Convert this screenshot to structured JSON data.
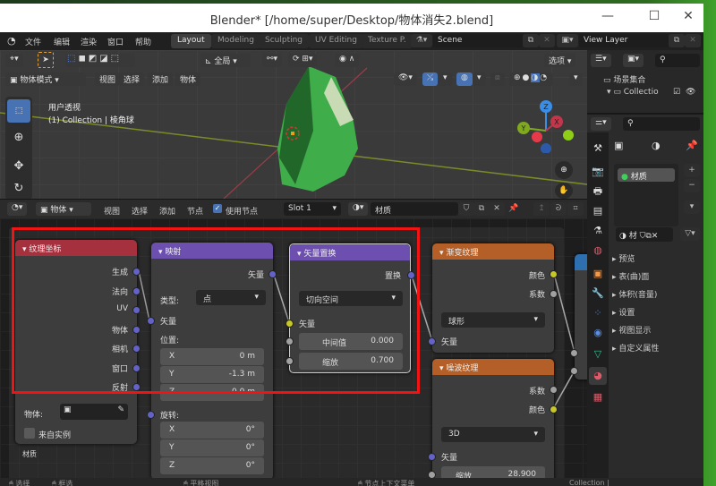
{
  "window": {
    "title": "Blender* [/home/super/Desktop/物体消失2.blend]",
    "minimize": "—",
    "maximize": "☐",
    "close": "✕"
  },
  "menubar": {
    "items": [
      "文件",
      "编辑",
      "渲染",
      "窗口",
      "帮助"
    ]
  },
  "workspaces": [
    {
      "label": "Layout",
      "active": true
    },
    {
      "label": "Modeling"
    },
    {
      "label": "Sculpting"
    },
    {
      "label": "UV Editing"
    },
    {
      "label": "Texture P."
    }
  ],
  "scene": {
    "name": "Scene",
    "view_layer": "View Layer"
  },
  "viewport": {
    "orientation": "全局",
    "options": "选项",
    "mode": "物体模式",
    "menus": [
      "视图",
      "选择",
      "添加",
      "物体"
    ],
    "overlay_title": "用户透视",
    "overlay_sub": "(1) Collection | 棱角球",
    "gizmo": {
      "x": "X",
      "y": "Y",
      "z": "Z"
    }
  },
  "node_editor": {
    "object_type": "物体",
    "menus": [
      "视图",
      "选择",
      "添加",
      "节点"
    ],
    "use_nodes_label": "使用节点",
    "use_nodes": true,
    "slot": "Slot 1",
    "material": "材质",
    "frame_label": "材质"
  },
  "nodes": {
    "texcoord": {
      "title": "纹理坐标",
      "outputs": [
        "生成",
        "法向",
        "UV",
        "物体",
        "相机",
        "窗口",
        "反射"
      ],
      "object_label": "物体:",
      "from_instancer": "来自实例"
    },
    "mapping": {
      "title": "映射",
      "output": "矢量",
      "type_label": "类型:",
      "type_value": "点",
      "vector_in": "矢量",
      "location_label": "位置:",
      "location": [
        {
          "axis": "X",
          "value": "0 m"
        },
        {
          "axis": "Y",
          "value": "-1.3 m"
        },
        {
          "axis": "Z",
          "value": "0.0 m"
        }
      ],
      "rotation_label": "旋转:",
      "rotation": [
        {
          "axis": "X",
          "value": "0°"
        },
        {
          "axis": "Y",
          "value": "0°"
        },
        {
          "axis": "Z",
          "value": "0°"
        }
      ]
    },
    "displacement": {
      "title": "矢量置换",
      "output": "置换",
      "space": "切向空间",
      "vector_in": "矢量",
      "midlevel_label": "中间值",
      "midlevel": "0.000",
      "scale_label": "缩放",
      "scale": "0.700"
    },
    "gradient": {
      "title": "渐变纹理",
      "outputs": [
        "颜色",
        "系数"
      ],
      "type": "球形",
      "vector_in": "矢量"
    },
    "noise": {
      "title": "噪波纹理",
      "outputs": [
        "系数",
        "颜色"
      ],
      "dims": "3D",
      "vector_in": "矢量",
      "scale_label": "缩放",
      "scale": "28.900"
    }
  },
  "outliner": {
    "root": "场景集合",
    "collection": "Collectio"
  },
  "properties": {
    "material_slot": "材质",
    "material_short": "材",
    "panels": [
      "预览",
      "表(曲)面",
      "体积(音量)",
      "设置",
      "视图显示",
      "自定义属性"
    ]
  },
  "statusbar": {
    "select": "选择",
    "box_select": "框选",
    "pan": "平移视图",
    "node_menu": "节点上下文菜单",
    "collection": "Collection |"
  }
}
